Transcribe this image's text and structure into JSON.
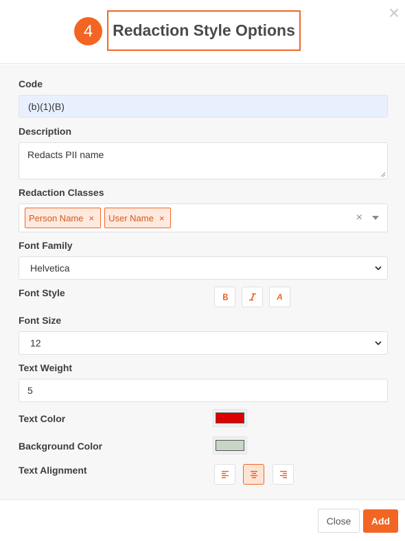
{
  "header": {
    "step_number": "4",
    "title": "Redaction Style Options"
  },
  "form": {
    "code": {
      "label": "Code",
      "value": "(b)(1)(B)"
    },
    "description": {
      "label": "Description",
      "value": "Redacts PII name"
    },
    "redaction_classes": {
      "label": "Redaction Classes",
      "tags": [
        "Person Name",
        "User Name"
      ],
      "tag_remove_glyph": "×",
      "clear_glyph": "×"
    },
    "font_family": {
      "label": "Font Family",
      "value": "Helvetica"
    },
    "font_style": {
      "label": "Font Style",
      "buttons": [
        {
          "glyph": "B",
          "icon": "bold-icon"
        },
        {
          "glyph": "I",
          "icon": "italic-icon"
        },
        {
          "glyph": "A",
          "icon": "underline-icon"
        }
      ]
    },
    "font_size": {
      "label": "Font Size",
      "value": "12"
    },
    "text_weight": {
      "label": "Text Weight",
      "value": "5"
    },
    "text_color": {
      "label": "Text Color",
      "color": "#dd0000"
    },
    "background_color": {
      "label": "Background Color",
      "color": "#c8d6c8"
    },
    "text_alignment": {
      "label": "Text Alignment",
      "options": [
        "left",
        "center",
        "right"
      ],
      "selected": "center"
    }
  },
  "footer": {
    "close_label": "Close",
    "add_label": "Add"
  },
  "colors": {
    "accent": "#f26522",
    "tag_bg": "#fde9de",
    "code_field_bg": "#e8f0fe"
  }
}
